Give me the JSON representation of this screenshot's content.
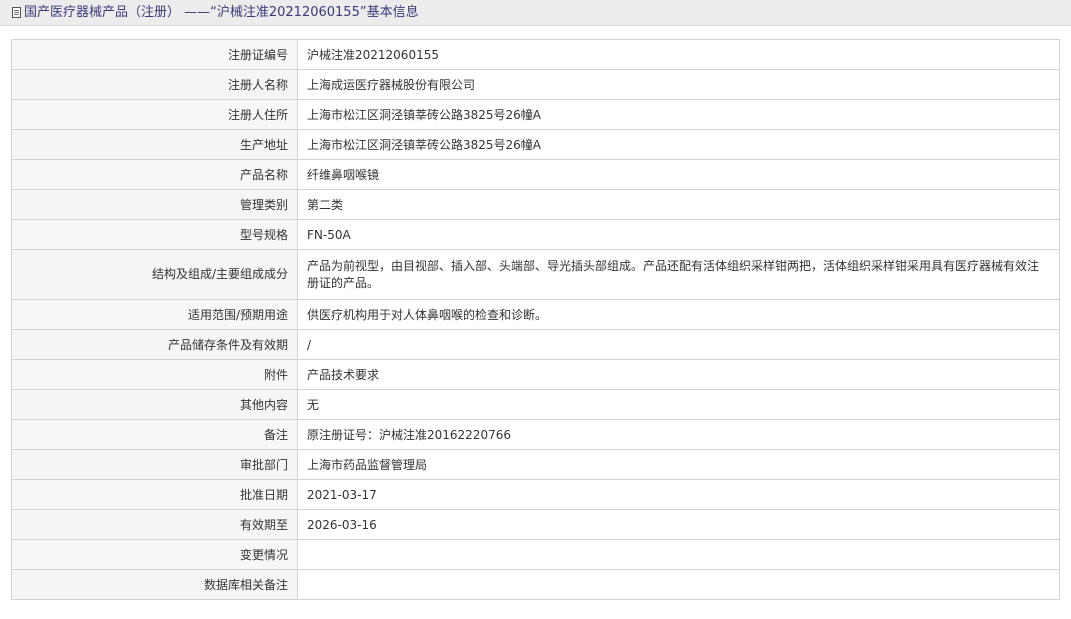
{
  "header": {
    "icon": "document-icon",
    "title": "国产医疗器械产品（注册） ——“沪械注准20212060155”基本信息"
  },
  "rows": [
    {
      "label": "注册证编号",
      "value": "沪械注准20212060155"
    },
    {
      "label": "注册人名称",
      "value": "上海成运医疗器械股份有限公司"
    },
    {
      "label": "注册人住所",
      "value": "上海市松江区洞泾镇莘砖公路3825号26幢A"
    },
    {
      "label": "生产地址",
      "value": "上海市松江区洞泾镇莘砖公路3825号26幢A"
    },
    {
      "label": "产品名称",
      "value": "纤维鼻咽喉镜"
    },
    {
      "label": "管理类别",
      "value": "第二类"
    },
    {
      "label": "型号规格",
      "value": "FN-50A"
    },
    {
      "label": "结构及组成/主要组成成分",
      "value": "产品为前视型，由目视部、插入部、头端部、导光插头部组成。产品还配有活体组织采样钳两把，活体组织采样钳采用具有医疗器械有效注册证的产品。"
    },
    {
      "label": "适用范围/预期用途",
      "value": "供医疗机构用于对人体鼻咽喉的检查和诊断。"
    },
    {
      "label": "产品储存条件及有效期",
      "value": "/"
    },
    {
      "label": "附件",
      "value": "产品技术要求"
    },
    {
      "label": "其他内容",
      "value": "无"
    },
    {
      "label": "备注",
      "value": "原注册证号：沪械注准20162220766"
    },
    {
      "label": "审批部门",
      "value": "上海市药品监督管理局"
    },
    {
      "label": "批准日期",
      "value": "2021-03-17"
    },
    {
      "label": "有效期至",
      "value": "2026-03-16"
    },
    {
      "label": "变更情况",
      "value": ""
    },
    {
      "label": "数据库相关备注",
      "value": ""
    }
  ]
}
